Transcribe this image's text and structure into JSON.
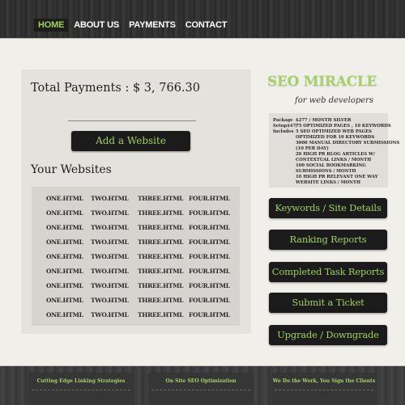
{
  "nav": {
    "items": [
      {
        "label": "HOME",
        "active": true
      },
      {
        "label": "ABOUT US",
        "active": false
      },
      {
        "label": "PAYMENTS",
        "active": false
      },
      {
        "label": "CONTACT",
        "active": false
      }
    ]
  },
  "main": {
    "total_payments": "Total Payments : $ 3, 766.30",
    "add_website_label": "Add a Website",
    "your_websites_title": "Your Websites",
    "websites_columns": [
      "ONE.HTML",
      "TWO.HTML",
      "THREE.HTML",
      "FOUR.HTML"
    ],
    "websites_row_count": 9
  },
  "sidebar": {
    "logo": "SEO MIRACLE",
    "tagline": "for web developers",
    "package": [
      {
        "key": "Package",
        "value": "$277 / MONTH SILVER"
      },
      {
        "key": "Setup$477",
        "value": "/ 5 OPTIMIZED PAGES , 10 KEYWORDS"
      },
      {
        "key": "Includes",
        "value": "5 SEO OPTIMIZED WEB PAGES"
      },
      {
        "key": "",
        "value": "OPTIMIZED FOR 10 KEYWORDS"
      },
      {
        "key": "",
        "value": "3000 MANUAL DIRECTORY SUBMISSIONS"
      },
      {
        "key": "",
        "value": "(10 PER DAY)"
      },
      {
        "key": "",
        "value": "20 HIGH PR BLOG ARTICLES W/"
      },
      {
        "key": "",
        "value": "CONTEXTUAL LINKS / MONTH"
      },
      {
        "key": "",
        "value": "100 SOCIAL BOOKMARKING"
      },
      {
        "key": "",
        "value": "SUBMISSIONS / MONTH"
      },
      {
        "key": "",
        "value": "10 HIGH PR RELEVANT ONE WAY"
      },
      {
        "key": "",
        "value": "WEBSITE LINKS / MONTH"
      }
    ],
    "buttons": [
      "Keywords / Site Details",
      "Ranking Reports",
      "Completed Task Reports",
      "Submit a Ticket",
      "Upgrade / Downgrade"
    ]
  },
  "footer": {
    "cards": [
      "Cutting Edge Linking Strategies",
      "On Site SEO Optimization",
      "We Do the Work, You Sign the Clients"
    ]
  },
  "colors": {
    "accent_green": "#9fcf62",
    "button_bg": "#1b1b1b",
    "page_bg": "#f1efea"
  }
}
